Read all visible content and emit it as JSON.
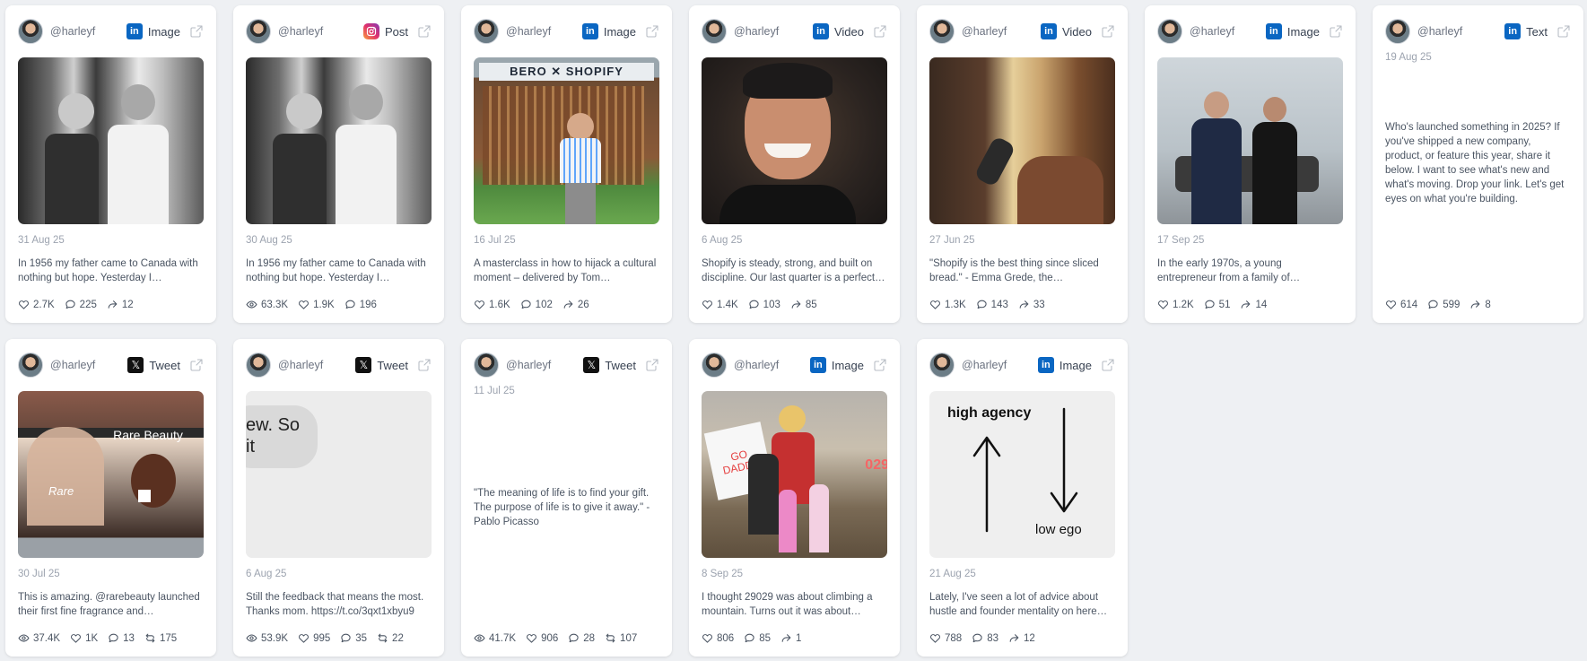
{
  "handle": "@harleyf",
  "colors": {
    "linkedin": "#0a66c2",
    "x": "#111111"
  },
  "row1": [
    {
      "platform": "Image",
      "platform_icon": "linkedin-icon",
      "date": "31 Aug 25",
      "caption": "In 1956 my father came to Canada with nothing but hope. Yesterday I received…",
      "stats": {
        "likes": "2.7K",
        "comments": "225",
        "shares": "12"
      }
    },
    {
      "platform": "Post",
      "platform_icon": "instagram-icon",
      "date": "30 Aug 25",
      "caption": "In 1956 my father came to Canada with nothing but hope. Yesterday I received…",
      "stats": {
        "views": "63.3K",
        "likes": "1.9K",
        "comments": "196"
      }
    },
    {
      "platform": "Image",
      "platform_icon": "linkedin-icon",
      "date": "16 Jul 25",
      "media_text": "BERO ✕ SHOPIFY",
      "caption": "A masterclass in how to hijack a cultural moment – delivered by Tom…",
      "stats": {
        "likes": "1.6K",
        "comments": "102",
        "shares": "26"
      }
    },
    {
      "platform": "Video",
      "platform_icon": "linkedin-icon",
      "date": "6 Aug 25",
      "caption": "Shopify is steady, strong, and built on discipline. Our last quarter is a perfect…",
      "stats": {
        "likes": "1.4K",
        "comments": "103",
        "shares": "85"
      }
    },
    {
      "platform": "Video",
      "platform_icon": "linkedin-icon",
      "date": "27 Jun 25",
      "caption": "\"Shopify is the best thing since sliced bread.\" - Emma Grede, the…",
      "stats": {
        "likes": "1.3K",
        "comments": "143",
        "shares": "33"
      }
    },
    {
      "platform": "Image",
      "platform_icon": "linkedin-icon",
      "date": "17 Sep 25",
      "caption": "In the early 1970s, a young entrepreneur from a family of…",
      "stats": {
        "likes": "1.2K",
        "comments": "51",
        "shares": "14"
      }
    },
    {
      "platform": "Text",
      "platform_icon": "linkedin-icon",
      "date": "19 Aug 25",
      "caption": "Who's launched something in 2025? If you've shipped a new company, product, or feature this year, share it below. I want to see what's new and what's moving. Drop your link. Let's get eyes on what you're building.",
      "stats": {
        "likes": "614",
        "comments": "599",
        "shares": "8"
      }
    }
  ],
  "row2": [
    {
      "platform": "Tweet",
      "platform_icon": "x-icon",
      "date": "30 Jul 25",
      "media_text": "Rare Beauty",
      "media_text2": "Rare",
      "caption": "This is amazing. @rarebeauty launched their first fine fragrance and…",
      "stats": {
        "views": "37.4K",
        "likes": "1K",
        "comments": "13",
        "retweets": "175"
      }
    },
    {
      "platform": "Tweet",
      "platform_icon": "x-icon",
      "date": "6 Aug 25",
      "media_text": "ew. So",
      "media_text2": "it",
      "caption": "Still the feedback that means the most. Thanks mom. https://t.co/3qxt1xbyu9",
      "stats": {
        "views": "53.9K",
        "likes": "995",
        "comments": "35",
        "retweets": "22"
      }
    },
    {
      "platform": "Tweet",
      "platform_icon": "x-icon",
      "date": "11 Jul 25",
      "caption": "\"The meaning of life is to find your gift. The purpose of life is to give it away.\" - Pablo Picasso",
      "stats": {
        "views": "41.7K",
        "likes": "906",
        "comments": "28",
        "retweets": "107"
      }
    },
    {
      "platform": "Image",
      "platform_icon": "linkedin-icon",
      "date": "8 Sep 25",
      "media_text": "GO DADDY",
      "media_text2": "029",
      "caption": "I thought 29029 was about climbing a mountain. Turns out it was about…",
      "stats": {
        "likes": "806",
        "comments": "85",
        "shares": "1"
      }
    },
    {
      "platform": "Image",
      "platform_icon": "linkedin-icon",
      "date": "21 Aug 25",
      "media_text": "high agency",
      "media_text2": "low ego",
      "caption": "Lately, I've seen a lot of advice about hustle and founder mentality on here…",
      "stats": {
        "likes": "788",
        "comments": "83",
        "shares": "12"
      }
    }
  ]
}
